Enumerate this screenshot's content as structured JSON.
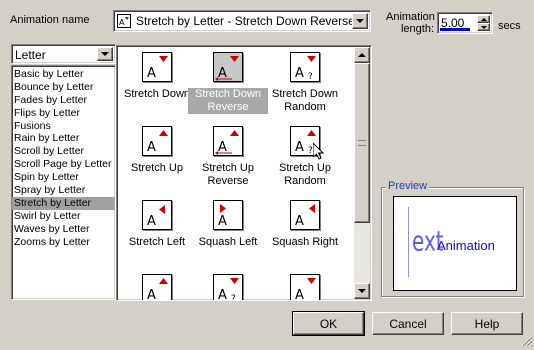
{
  "header": {
    "anim_name_label": "Animation name",
    "anim_name_value": "Stretch by Letter - Stretch Down Reverse",
    "length_label_1": "Animation",
    "length_label_2": "length:",
    "length_value": "5.00",
    "length_unit": "secs"
  },
  "category": {
    "selected": "Letter",
    "items": [
      "Basic by Letter",
      "Bounce by Letter",
      "Fades by Letter",
      "Flips by Letter",
      "Fusions",
      "Rain by Letter",
      "Scroll by Letter",
      "Scroll Page by Letter",
      "Spin by Letter",
      "Spray by Letter",
      "Stretch by Letter",
      "Swirl by Letter",
      "Waves by Letter",
      "Zooms by Letter"
    ],
    "selected_index": 10
  },
  "tiles": [
    {
      "label": "Stretch Down"
    },
    {
      "label": "Stretch Down Reverse"
    },
    {
      "label": "Stretch Down Random"
    },
    {
      "label": "Stretch Up"
    },
    {
      "label": "Stretch Up Reverse"
    },
    {
      "label": "Stretch Up Random"
    },
    {
      "label": "Stretch Left"
    },
    {
      "label": "Squash Left"
    },
    {
      "label": "Squash Right"
    }
  ],
  "preview": {
    "label": "Preview",
    "text_partial": "ext",
    "text": "Animation"
  },
  "buttons": {
    "ok": "OK",
    "cancel": "Cancel",
    "help": "Help"
  },
  "colors": {
    "face": "#d4d0c8",
    "selection": "#a0a0a0",
    "preview_text": "#1010c8",
    "icon_red": "#cc0000"
  }
}
